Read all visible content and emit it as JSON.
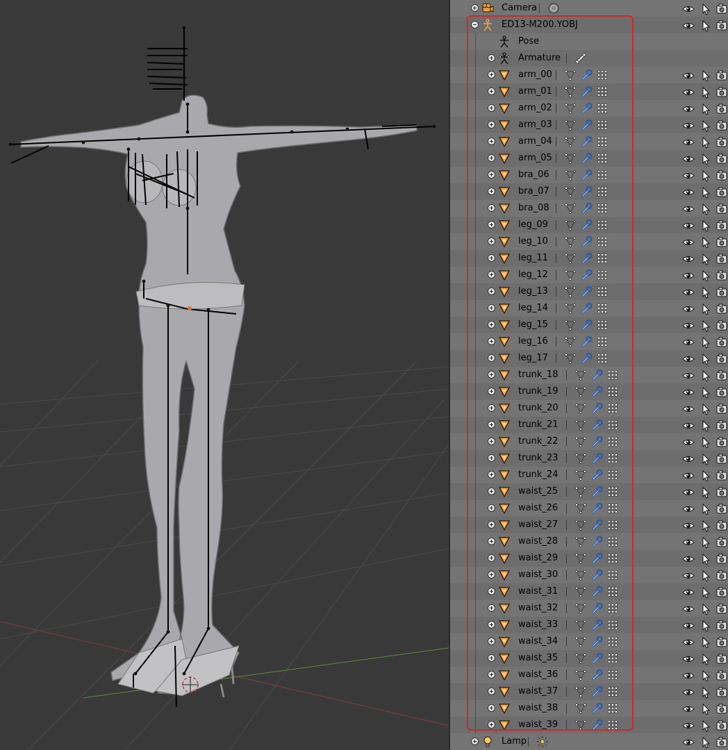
{
  "outliner": {
    "rows": [
      {
        "name": "Camera",
        "type": "camera",
        "indent": 0,
        "expander": "plus",
        "extra": [
          "camera-data"
        ],
        "restrict": [
          "eye",
          "cursor",
          "render"
        ]
      },
      {
        "name": "ED13-M200.YOBJ",
        "type": "empty",
        "indent": 0,
        "expander": "minus",
        "extra": [],
        "restrict": [
          "eye",
          "cursor",
          "render"
        ]
      },
      {
        "name": "Pose",
        "type": "pose",
        "indent": 1,
        "expander": "none",
        "extra": [],
        "restrict": []
      },
      {
        "name": "Armature",
        "type": "armature",
        "indent": 1,
        "expander": "plus",
        "extra": [
          "bone"
        ],
        "restrict": []
      },
      {
        "name": "arm_00",
        "type": "mesh",
        "indent": 1,
        "expander": "plus",
        "extra": [
          "vertex-group",
          "modifier",
          "mesh-data"
        ],
        "restrict": [
          "eye",
          "cursor",
          "render"
        ]
      },
      {
        "name": "arm_01",
        "type": "mesh",
        "indent": 1,
        "expander": "plus",
        "extra": [
          "vertex-group",
          "modifier",
          "mesh-data"
        ],
        "restrict": [
          "eye",
          "cursor",
          "render"
        ]
      },
      {
        "name": "arm_02",
        "type": "mesh",
        "indent": 1,
        "expander": "plus",
        "extra": [
          "vertex-group",
          "modifier",
          "mesh-data"
        ],
        "restrict": [
          "eye",
          "cursor",
          "render"
        ]
      },
      {
        "name": "arm_03",
        "type": "mesh",
        "indent": 1,
        "expander": "plus",
        "extra": [
          "vertex-group",
          "modifier",
          "mesh-data"
        ],
        "restrict": [
          "eye",
          "cursor",
          "render"
        ]
      },
      {
        "name": "arm_04",
        "type": "mesh",
        "indent": 1,
        "expander": "plus",
        "extra": [
          "vertex-group",
          "modifier",
          "mesh-data"
        ],
        "restrict": [
          "eye",
          "cursor",
          "render"
        ]
      },
      {
        "name": "arm_05",
        "type": "mesh",
        "indent": 1,
        "expander": "plus",
        "extra": [
          "vertex-group",
          "modifier",
          "mesh-data"
        ],
        "restrict": [
          "eye",
          "cursor",
          "render"
        ]
      },
      {
        "name": "bra_06",
        "type": "mesh",
        "indent": 1,
        "expander": "plus",
        "extra": [
          "vertex-group",
          "modifier",
          "mesh-data"
        ],
        "restrict": [
          "eye",
          "cursor",
          "render"
        ]
      },
      {
        "name": "bra_07",
        "type": "mesh",
        "indent": 1,
        "expander": "plus",
        "extra": [
          "vertex-group",
          "modifier",
          "mesh-data"
        ],
        "restrict": [
          "eye",
          "cursor",
          "render"
        ]
      },
      {
        "name": "bra_08",
        "type": "mesh",
        "indent": 1,
        "expander": "plus",
        "extra": [
          "vertex-group",
          "modifier",
          "mesh-data"
        ],
        "restrict": [
          "eye",
          "cursor",
          "render"
        ]
      },
      {
        "name": "leg_09",
        "type": "mesh",
        "indent": 1,
        "expander": "plus",
        "extra": [
          "vertex-group",
          "modifier",
          "mesh-data"
        ],
        "restrict": [
          "eye",
          "cursor",
          "render"
        ]
      },
      {
        "name": "leg_10",
        "type": "mesh",
        "indent": 1,
        "expander": "plus",
        "extra": [
          "vertex-group",
          "modifier",
          "mesh-data"
        ],
        "restrict": [
          "eye",
          "cursor",
          "render"
        ]
      },
      {
        "name": "leg_11",
        "type": "mesh",
        "indent": 1,
        "expander": "plus",
        "extra": [
          "vertex-group",
          "modifier",
          "mesh-data"
        ],
        "restrict": [
          "eye",
          "cursor",
          "render"
        ]
      },
      {
        "name": "leg_12",
        "type": "mesh",
        "indent": 1,
        "expander": "plus",
        "extra": [
          "vertex-group",
          "modifier",
          "mesh-data"
        ],
        "restrict": [
          "eye",
          "cursor",
          "render"
        ]
      },
      {
        "name": "leg_13",
        "type": "mesh",
        "indent": 1,
        "expander": "plus",
        "extra": [
          "vertex-group",
          "modifier",
          "mesh-data"
        ],
        "restrict": [
          "eye",
          "cursor",
          "render"
        ]
      },
      {
        "name": "leg_14",
        "type": "mesh",
        "indent": 1,
        "expander": "plus",
        "extra": [
          "vertex-group",
          "modifier",
          "mesh-data"
        ],
        "restrict": [
          "eye",
          "cursor",
          "render"
        ]
      },
      {
        "name": "leg_15",
        "type": "mesh",
        "indent": 1,
        "expander": "plus",
        "extra": [
          "vertex-group",
          "modifier",
          "mesh-data"
        ],
        "restrict": [
          "eye",
          "cursor",
          "render"
        ]
      },
      {
        "name": "leg_16",
        "type": "mesh",
        "indent": 1,
        "expander": "plus",
        "extra": [
          "vertex-group",
          "modifier",
          "mesh-data"
        ],
        "restrict": [
          "eye",
          "cursor",
          "render"
        ]
      },
      {
        "name": "leg_17",
        "type": "mesh",
        "indent": 1,
        "expander": "plus",
        "extra": [
          "vertex-group",
          "modifier",
          "mesh-data"
        ],
        "restrict": [
          "eye",
          "cursor",
          "render"
        ]
      },
      {
        "name": "trunk_18",
        "type": "mesh",
        "indent": 1,
        "expander": "plus",
        "extra": [
          "vertex-group",
          "modifier",
          "mesh-data"
        ],
        "restrict": [
          "eye",
          "cursor",
          "render"
        ]
      },
      {
        "name": "trunk_19",
        "type": "mesh",
        "indent": 1,
        "expander": "plus",
        "extra": [
          "vertex-group",
          "modifier",
          "mesh-data"
        ],
        "restrict": [
          "eye",
          "cursor",
          "render"
        ]
      },
      {
        "name": "trunk_20",
        "type": "mesh",
        "indent": 1,
        "expander": "plus",
        "extra": [
          "vertex-group",
          "modifier",
          "mesh-data"
        ],
        "restrict": [
          "eye",
          "cursor",
          "render"
        ]
      },
      {
        "name": "trunk_21",
        "type": "mesh",
        "indent": 1,
        "expander": "plus",
        "extra": [
          "vertex-group",
          "modifier",
          "mesh-data"
        ],
        "restrict": [
          "eye",
          "cursor",
          "render"
        ]
      },
      {
        "name": "trunk_22",
        "type": "mesh",
        "indent": 1,
        "expander": "plus",
        "extra": [
          "vertex-group",
          "modifier",
          "mesh-data"
        ],
        "restrict": [
          "eye",
          "cursor",
          "render"
        ]
      },
      {
        "name": "trunk_23",
        "type": "mesh",
        "indent": 1,
        "expander": "plus",
        "extra": [
          "vertex-group",
          "modifier",
          "mesh-data"
        ],
        "restrict": [
          "eye",
          "cursor",
          "render"
        ]
      },
      {
        "name": "trunk_24",
        "type": "mesh",
        "indent": 1,
        "expander": "plus",
        "extra": [
          "vertex-group",
          "modifier",
          "mesh-data"
        ],
        "restrict": [
          "eye",
          "cursor",
          "render"
        ]
      },
      {
        "name": "waist_25",
        "type": "mesh",
        "indent": 1,
        "expander": "plus",
        "extra": [
          "vertex-group",
          "modifier",
          "mesh-data"
        ],
        "restrict": [
          "eye",
          "cursor",
          "render"
        ]
      },
      {
        "name": "waist_26",
        "type": "mesh",
        "indent": 1,
        "expander": "plus",
        "extra": [
          "vertex-group",
          "modifier",
          "mesh-data"
        ],
        "restrict": [
          "eye",
          "cursor",
          "render"
        ]
      },
      {
        "name": "waist_27",
        "type": "mesh",
        "indent": 1,
        "expander": "plus",
        "extra": [
          "vertex-group",
          "modifier",
          "mesh-data"
        ],
        "restrict": [
          "eye",
          "cursor",
          "render"
        ]
      },
      {
        "name": "waist_28",
        "type": "mesh",
        "indent": 1,
        "expander": "plus",
        "extra": [
          "vertex-group",
          "modifier",
          "mesh-data"
        ],
        "restrict": [
          "eye",
          "cursor",
          "render"
        ]
      },
      {
        "name": "waist_29",
        "type": "mesh",
        "indent": 1,
        "expander": "plus",
        "extra": [
          "vertex-group",
          "modifier",
          "mesh-data"
        ],
        "restrict": [
          "eye",
          "cursor",
          "render"
        ]
      },
      {
        "name": "waist_30",
        "type": "mesh",
        "indent": 1,
        "expander": "plus",
        "extra": [
          "vertex-group",
          "modifier",
          "mesh-data"
        ],
        "restrict": [
          "eye",
          "cursor",
          "render"
        ]
      },
      {
        "name": "waist_31",
        "type": "mesh",
        "indent": 1,
        "expander": "plus",
        "extra": [
          "vertex-group",
          "modifier",
          "mesh-data"
        ],
        "restrict": [
          "eye",
          "cursor",
          "render"
        ]
      },
      {
        "name": "waist_32",
        "type": "mesh",
        "indent": 1,
        "expander": "plus",
        "extra": [
          "vertex-group",
          "modifier",
          "mesh-data"
        ],
        "restrict": [
          "eye",
          "cursor",
          "render"
        ]
      },
      {
        "name": "waist_33",
        "type": "mesh",
        "indent": 1,
        "expander": "plus",
        "extra": [
          "vertex-group",
          "modifier",
          "mesh-data"
        ],
        "restrict": [
          "eye",
          "cursor",
          "render"
        ]
      },
      {
        "name": "waist_34",
        "type": "mesh",
        "indent": 1,
        "expander": "plus",
        "extra": [
          "vertex-group",
          "modifier",
          "mesh-data"
        ],
        "restrict": [
          "eye",
          "cursor",
          "render"
        ]
      },
      {
        "name": "waist_35",
        "type": "mesh",
        "indent": 1,
        "expander": "plus",
        "extra": [
          "vertex-group",
          "modifier",
          "mesh-data"
        ],
        "restrict": [
          "eye",
          "cursor",
          "render"
        ]
      },
      {
        "name": "waist_36",
        "type": "mesh",
        "indent": 1,
        "expander": "plus",
        "extra": [
          "vertex-group",
          "modifier",
          "mesh-data"
        ],
        "restrict": [
          "eye",
          "cursor",
          "render"
        ]
      },
      {
        "name": "waist_37",
        "type": "mesh",
        "indent": 1,
        "expander": "plus",
        "extra": [
          "vertex-group",
          "modifier",
          "mesh-data"
        ],
        "restrict": [
          "eye",
          "cursor",
          "render"
        ]
      },
      {
        "name": "waist_38",
        "type": "mesh",
        "indent": 1,
        "expander": "plus",
        "extra": [
          "vertex-group",
          "modifier",
          "mesh-data"
        ],
        "restrict": [
          "eye",
          "cursor",
          "render"
        ]
      },
      {
        "name": "waist_39",
        "type": "mesh",
        "indent": 1,
        "expander": "plus",
        "extra": [
          "vertex-group",
          "modifier",
          "mesh-data"
        ],
        "restrict": [
          "eye",
          "cursor",
          "render"
        ]
      },
      {
        "name": "Lamp",
        "type": "lamp",
        "indent": 0,
        "expander": "plus",
        "extra": [
          "lamp-data"
        ],
        "restrict": [
          "eye",
          "cursor",
          "render"
        ]
      }
    ]
  },
  "viewport": {
    "background_color": "#393939",
    "grid_color": "#4a4a4a",
    "x_axis_color": "#8a3c3c",
    "y_axis_color": "#5d8a3d",
    "model_color": "#a9a9ad",
    "rig_color": "#000000"
  },
  "highlight_color": "#d6252a"
}
